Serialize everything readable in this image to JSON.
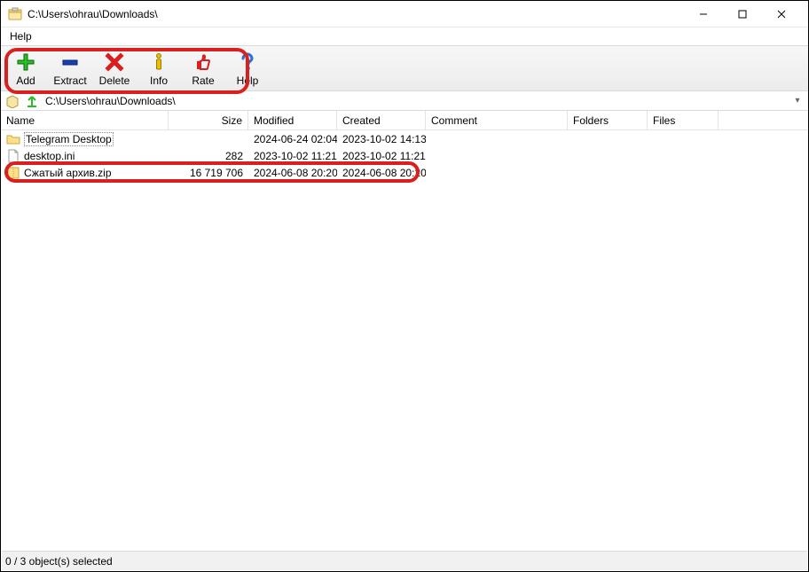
{
  "window": {
    "title": "C:\\Users\\ohrau\\Downloads\\"
  },
  "menu": {
    "help": "Help"
  },
  "toolbar": {
    "add": "Add",
    "extract": "Extract",
    "delete": "Delete",
    "info": "Info",
    "rate": "Rate",
    "help": "Help"
  },
  "pathbar": {
    "path": "C:\\Users\\ohrau\\Downloads\\"
  },
  "columns": {
    "name": "Name",
    "size": "Size",
    "modified": "Modified",
    "created": "Created",
    "comment": "Comment",
    "folders": "Folders",
    "files": "Files"
  },
  "rows": [
    {
      "icon": "folder",
      "name": "Telegram Desktop",
      "size": "",
      "modified": "2024-06-24 02:04",
      "created": "2023-10-02 14:13"
    },
    {
      "icon": "file",
      "name": "desktop.ini",
      "size": "282",
      "modified": "2023-10-02 11:21",
      "created": "2023-10-02 11:21"
    },
    {
      "icon": "zip",
      "name": "Сжатый архив.zip",
      "size": "16 719 706",
      "modified": "2024-06-08 20:20",
      "created": "2024-06-08 20:20"
    }
  ],
  "status": {
    "text": "0 / 3 object(s) selected"
  }
}
